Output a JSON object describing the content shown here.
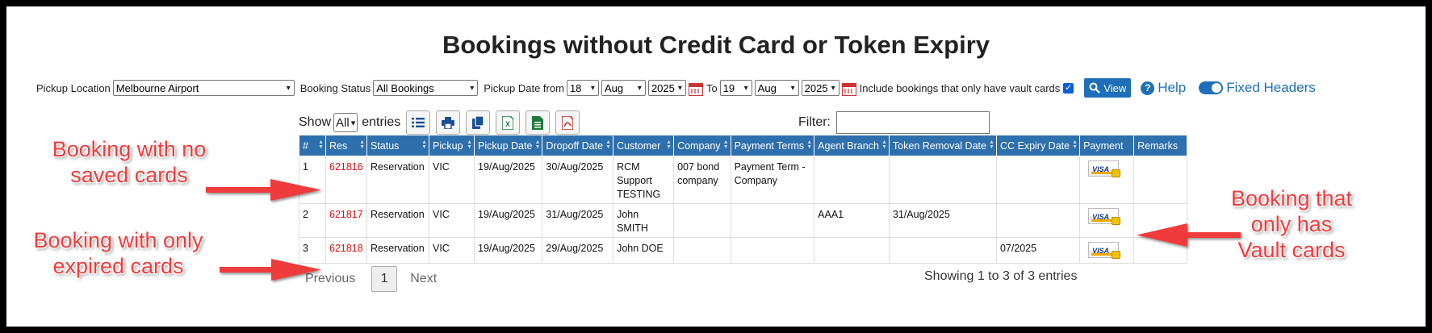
{
  "title": "Bookings without Credit Card or Token Expiry",
  "filters": {
    "pickup_location_label": "Pickup Location",
    "pickup_location_value": "Melbourne Airport",
    "booking_status_label": "Booking Status",
    "booking_status_value": "All Bookings",
    "pickup_date_from_label": "Pickup Date from",
    "from_day": "18",
    "from_month": "Aug",
    "from_year": "2025",
    "to_label": "To",
    "to_day": "19",
    "to_month": "Aug",
    "to_year": "2025",
    "vault_label": "Include bookings that only have vault cards",
    "vault_checked": true,
    "view_label": "View",
    "help_label": "Help",
    "fixed_headers_label": "Fixed Headers"
  },
  "table_controls": {
    "show_label": "Show",
    "entries_value": "All",
    "entries_label": "entries",
    "filter_label": "Filter:"
  },
  "columns": [
    "#",
    "Res",
    "Status",
    "Pickup",
    "Pickup Date",
    "Dropoff Date",
    "Customer",
    "Company",
    "Payment Terms",
    "Agent Branch",
    "Token Removal Date",
    "CC Expiry Date",
    "Payment",
    "Remarks"
  ],
  "rows": [
    {
      "num": "1",
      "res": "621816",
      "status": "Reservation",
      "pickup": "VIC",
      "pickup_date": "19/Aug/2025",
      "dropoff_date": "30/Aug/2025",
      "customer": "RCM Support TESTING",
      "company": "007 bond company",
      "payment_terms": "Payment Term - Company",
      "agent_branch": "",
      "token_removal_date": "",
      "cc_expiry_date": "",
      "remarks": ""
    },
    {
      "num": "2",
      "res": "621817",
      "status": "Reservation",
      "pickup": "VIC",
      "pickup_date": "19/Aug/2025",
      "dropoff_date": "31/Aug/2025",
      "customer": "John SMITH",
      "company": "",
      "payment_terms": "",
      "agent_branch": "AAA1",
      "token_removal_date": "31/Aug/2025",
      "cc_expiry_date": "",
      "remarks": ""
    },
    {
      "num": "3",
      "res": "621818",
      "status": "Reservation",
      "pickup": "VIC",
      "pickup_date": "19/Aug/2025",
      "dropoff_date": "29/Aug/2025",
      "customer": "John DOE",
      "company": "",
      "payment_terms": "",
      "agent_branch": "",
      "token_removal_date": "",
      "cc_expiry_date": "07/2025",
      "remarks": ""
    }
  ],
  "card_icon_text": "VISA",
  "pagination": {
    "previous_label": "Previous",
    "current_page": "1",
    "next_label": "Next",
    "info": "Showing 1 to 3 of 3 entries"
  },
  "annotations": {
    "no_saved_cards": [
      "Booking with no",
      "saved cards"
    ],
    "only_expired": [
      "Booking with only",
      "expired cards"
    ],
    "only_vault": [
      "Booking that",
      "only has",
      "Vault cards"
    ]
  },
  "colors": {
    "header_blue": "#2e6fad",
    "accent_blue": "#1e6fb8",
    "annotation_red": "#ef3b3b",
    "res_link_red": "#dd1111"
  },
  "icons": {
    "view": "search-icon",
    "help": "question-circle-icon",
    "columns": "list-icon",
    "print": "print-icon",
    "copy": "copy-icon",
    "excel": "excel-icon",
    "csv": "csv-icon",
    "pdf": "pdf-icon",
    "calendar": "calendar-icon",
    "payment": "visa-card-icon"
  }
}
